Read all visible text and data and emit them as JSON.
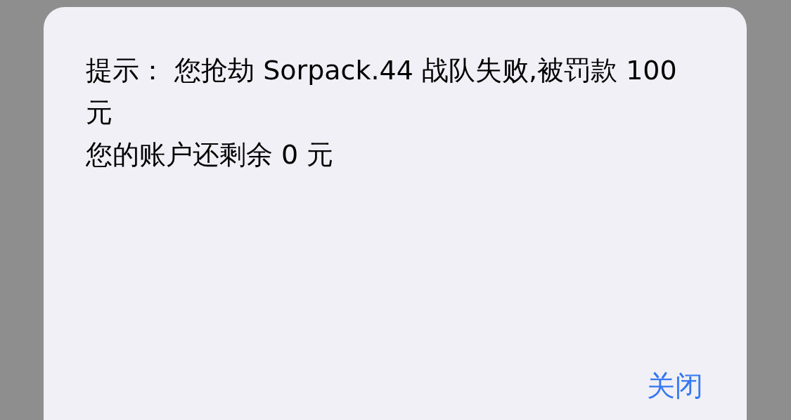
{
  "alert": {
    "message": "提示：  您抢劫 Sorpack.44 战队失败,被罚款 100 元",
    "balance": "您的账户还剩余 0 元",
    "close_button": "关闭"
  }
}
